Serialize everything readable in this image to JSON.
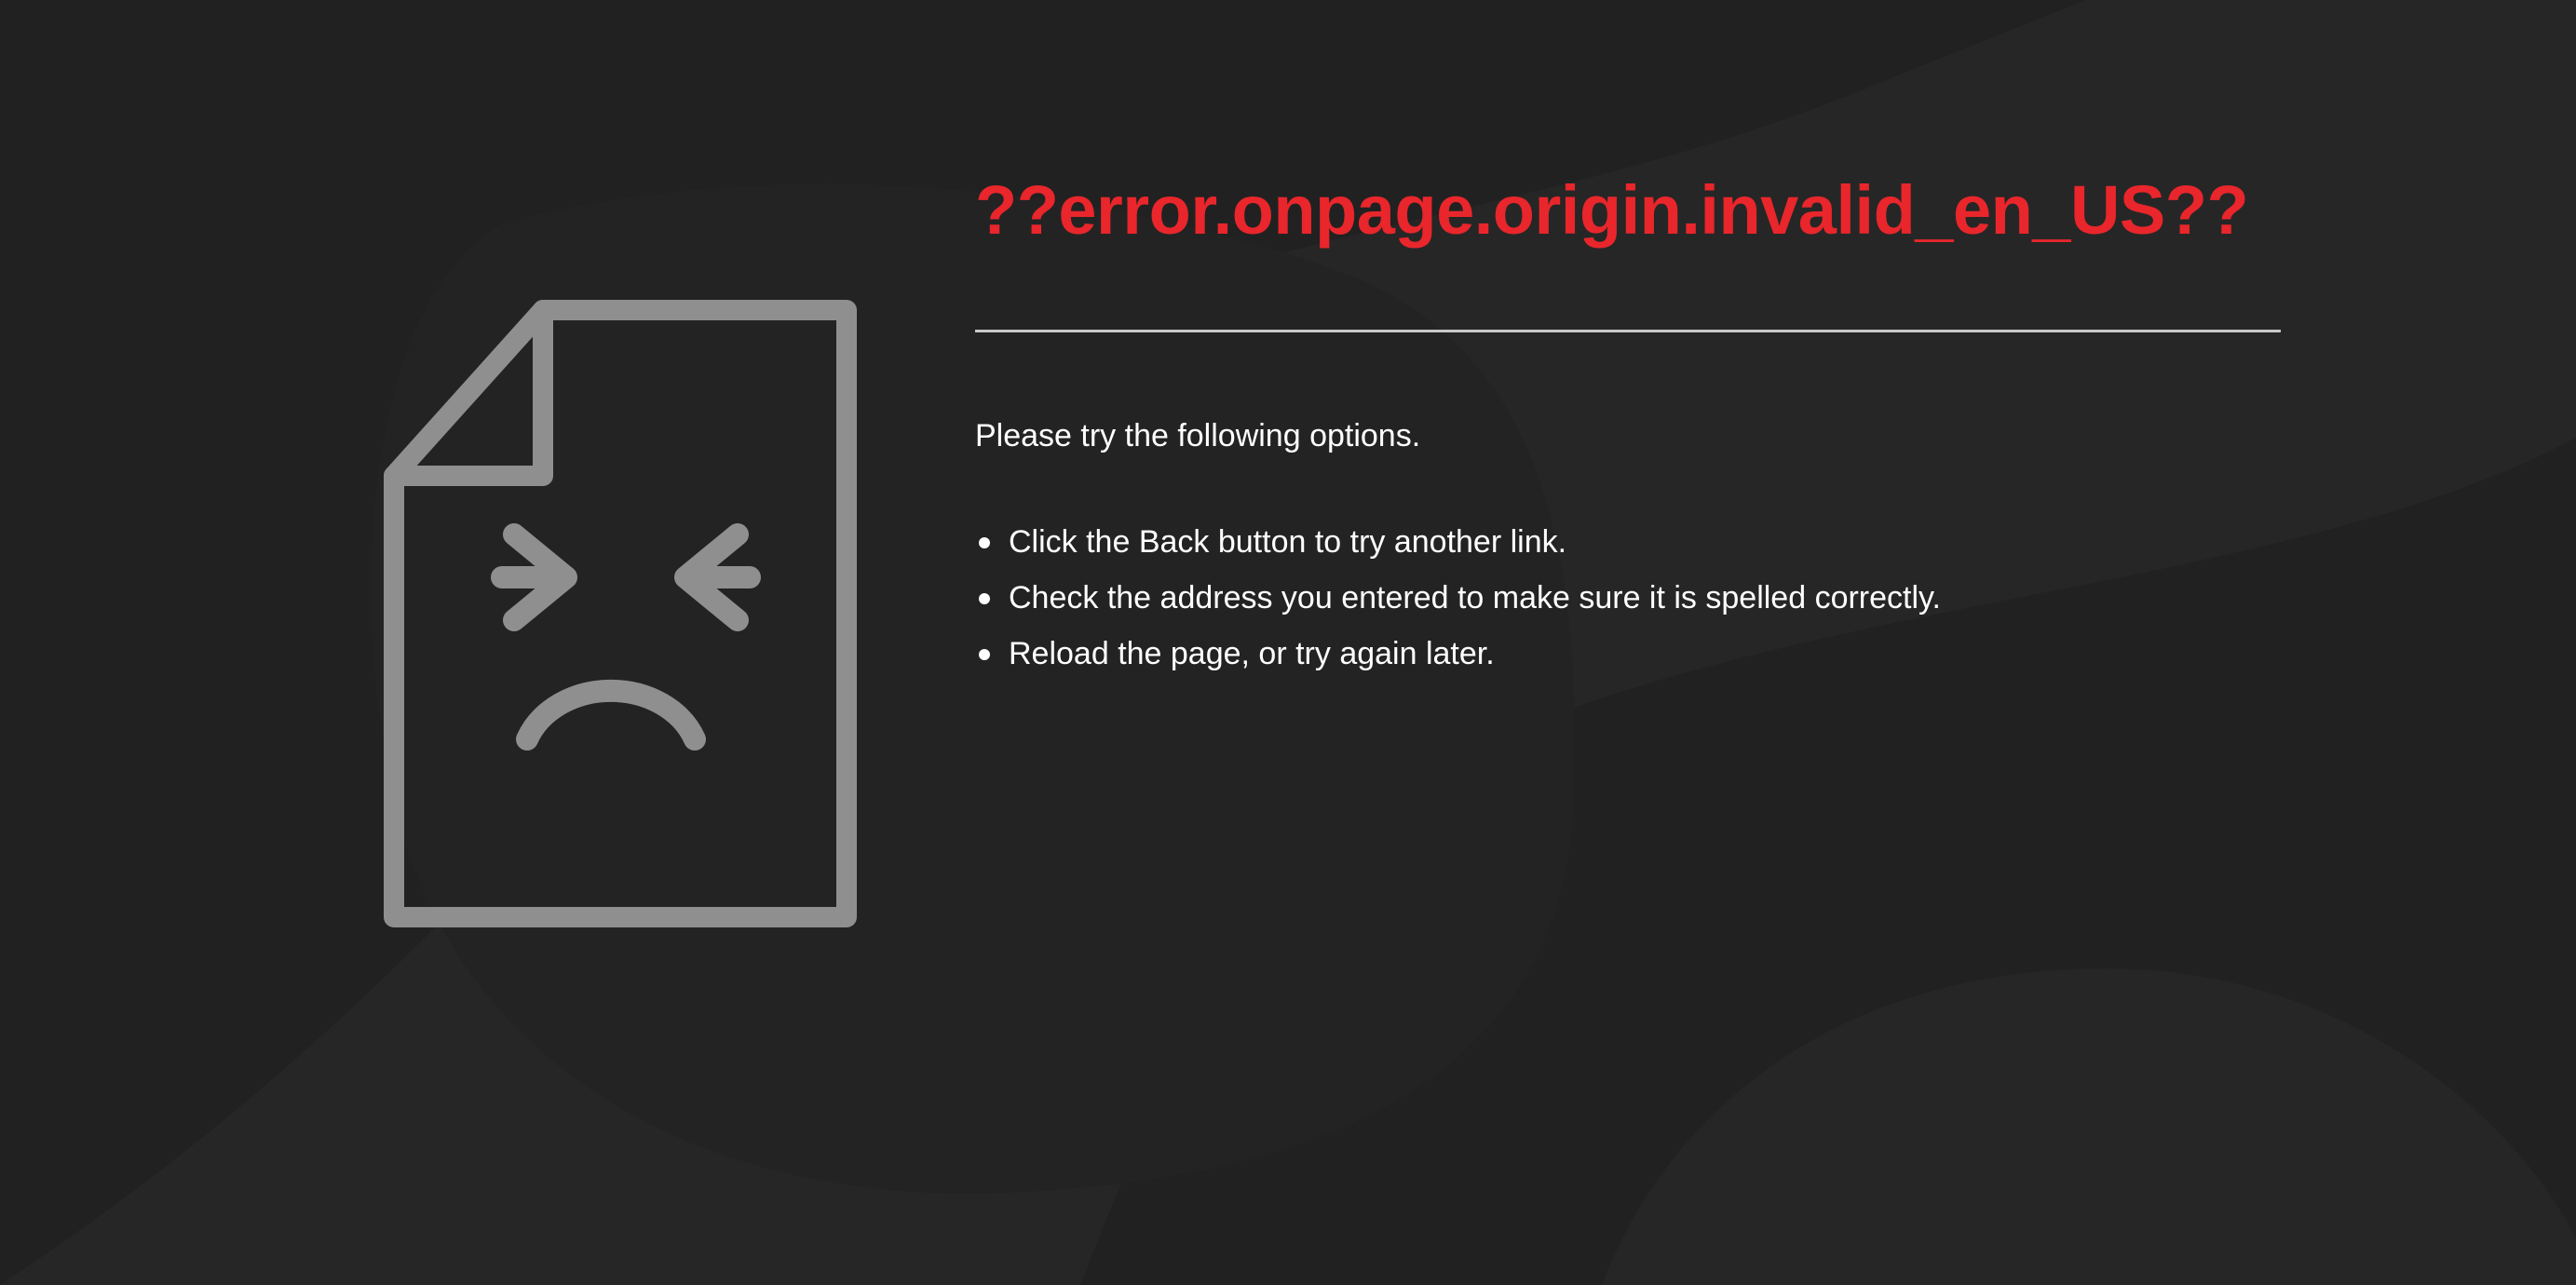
{
  "colors": {
    "background": "#212121",
    "title": "#e8262b",
    "text": "#ffffff",
    "illustration": "#8f8f8f",
    "divider": "#c9c9c9"
  },
  "illustration": {
    "icon": "sad-document-icon"
  },
  "error": {
    "title": "??error.onpage.origin.invalid_en_US??",
    "intro": "Please try the following options.",
    "options": [
      "Click the Back button to try another link.",
      "Check the address you entered to make sure it is spelled correctly.",
      "Reload the page, or try again later."
    ]
  }
}
